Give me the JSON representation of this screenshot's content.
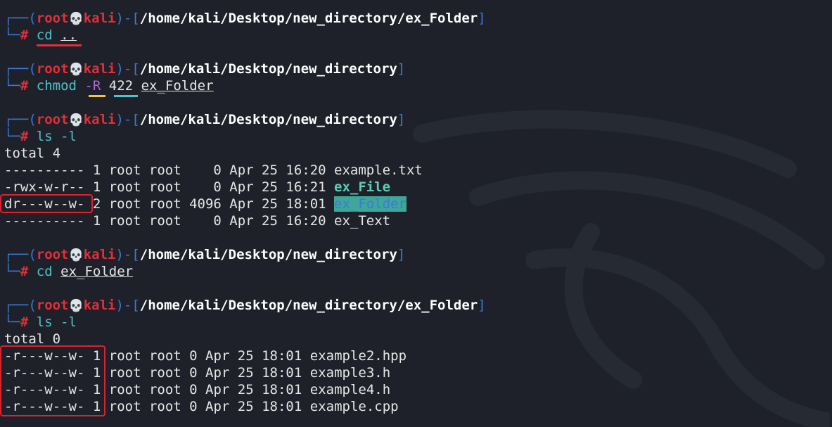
{
  "prompt": {
    "corner_top": "┌──(",
    "corner_bottom": "└─",
    "user": "root",
    "skull": "💀",
    "host": "kali",
    "open": ")-[",
    "close": "]",
    "hash": "#"
  },
  "blocks": [
    {
      "path": "/home/kali/Desktop/new_directory/ex_Folder",
      "cmd": "cd",
      "args": ".."
    },
    {
      "path": "/home/kali/Desktop/new_directory",
      "cmd": "chmod",
      "flag": "-R",
      "mode": "422",
      "target": "ex_Folder"
    },
    {
      "path": "/home/kali/Desktop/new_directory",
      "cmd": "ls -l",
      "total": "total 4",
      "rows": [
        {
          "perms": "----------",
          "meta": "1 root root    0 Apr 25 16:20",
          "name": "example.txt"
        },
        {
          "perms": "-rwx-w-r--",
          "meta": "1 root root    0 Apr 25 16:21",
          "name": "ex_File"
        },
        {
          "perms": "dr---w--w-",
          "meta": "2 root root 4096 Apr 25 18:01",
          "name": "ex_Folder"
        },
        {
          "perms": "----------",
          "meta": "1 root root    0 Apr 25 16:20",
          "name": "ex_Text"
        }
      ]
    },
    {
      "path": "/home/kali/Desktop/new_directory",
      "cmd": "cd",
      "args": "ex_Folder"
    },
    {
      "path": "/home/kali/Desktop/new_directory/ex_Folder",
      "cmd": "ls -l",
      "total": "total 0",
      "rows": [
        {
          "perms": "-r---w--w-",
          "links": "1",
          "meta": "root root 0 Apr 25 18:01",
          "name": "example2.hpp"
        },
        {
          "perms": "-r---w--w-",
          "links": "1",
          "meta": "root root 0 Apr 25 18:01",
          "name": "example3.h"
        },
        {
          "perms": "-r---w--w-",
          "links": "1",
          "meta": "root root 0 Apr 25 18:01",
          "name": "example4.h"
        },
        {
          "perms": "-r---w--w-",
          "links": "1",
          "meta": "root root 0 Apr 25 18:01",
          "name": "example.cpp"
        }
      ]
    }
  ],
  "colors": {
    "background": "#1e2129",
    "prompt_lines": "#3a7bd5",
    "user_host": "#e0303a",
    "command": "#4fc3c8",
    "flag": "#b06ad6",
    "highlight_box": "#d9232f",
    "underline_flag": "#f2c14e",
    "underline_mode": "#4fc3c8"
  }
}
